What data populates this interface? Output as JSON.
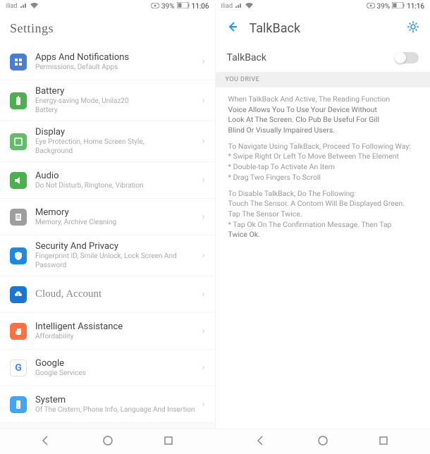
{
  "left": {
    "statusbar": {
      "carrier": "iliad",
      "battery": "39%",
      "time": "11:06"
    },
    "title": "Settings",
    "items": [
      {
        "title": "Apps And Notifications",
        "sub": "Permissions, Default Apps"
      },
      {
        "title": "Battery",
        "sub": "Energy-saving Mode, Unilaz20",
        "sub2": "Battery"
      },
      {
        "title": "Display",
        "sub": "Eye Protection, Home Screen Style,",
        "sub2": "Background"
      },
      {
        "title": "Audio",
        "sub": "Do Not Disturb, Ringtone, Vibration"
      },
      {
        "title": "Memory",
        "sub": "Memory, Archive Cleaning"
      },
      {
        "title": "Security And Privacy",
        "sub": "Fingerprint ID, Smile Unlock, Lock Screen And Password"
      },
      {
        "title": "Cloud, Account",
        "sub": ""
      },
      {
        "title": "Intelligent Assistance",
        "sub": "Affordability"
      },
      {
        "title": "Google",
        "sub": "Google Services"
      },
      {
        "title": "System",
        "sub": "Of The Cistern, Phone Info, Language And Insertion"
      }
    ]
  },
  "right": {
    "statusbar": {
      "carrier": "iliad",
      "battery": "39%",
      "time": "11:16"
    },
    "title": "TalkBack",
    "toggle_label": "TalkBack",
    "section": "YOU DRIVE",
    "para1a": "When TalkBack And Active, The Reading Function",
    "para1b": "Voice Allows You To Use Your Device Without",
    "para1c": "Look At The Screen. Clo Pub Be Useful For Gill",
    "para1d": "Blind Or Visually Impaired Users.",
    "para2a": "To Navigate Using TalkBack, Proceed To Following Way:",
    "para2b": "* Swipe Right Or Left To Move Between The Element",
    "para2c": "* Double-tap To Activate An Item",
    "para2d": "* Drag Two Fingers To Scroll",
    "para3a": "To Disable TalkBack, Do The Following:",
    "para3b": "Touch The Sensor. A Contom Will Be Displayed Green. Tap The Sensor Twice.",
    "para3c": "* Tap Ok On The Confirmation Message. Then Tap",
    "para3d": "Twice Ok."
  }
}
